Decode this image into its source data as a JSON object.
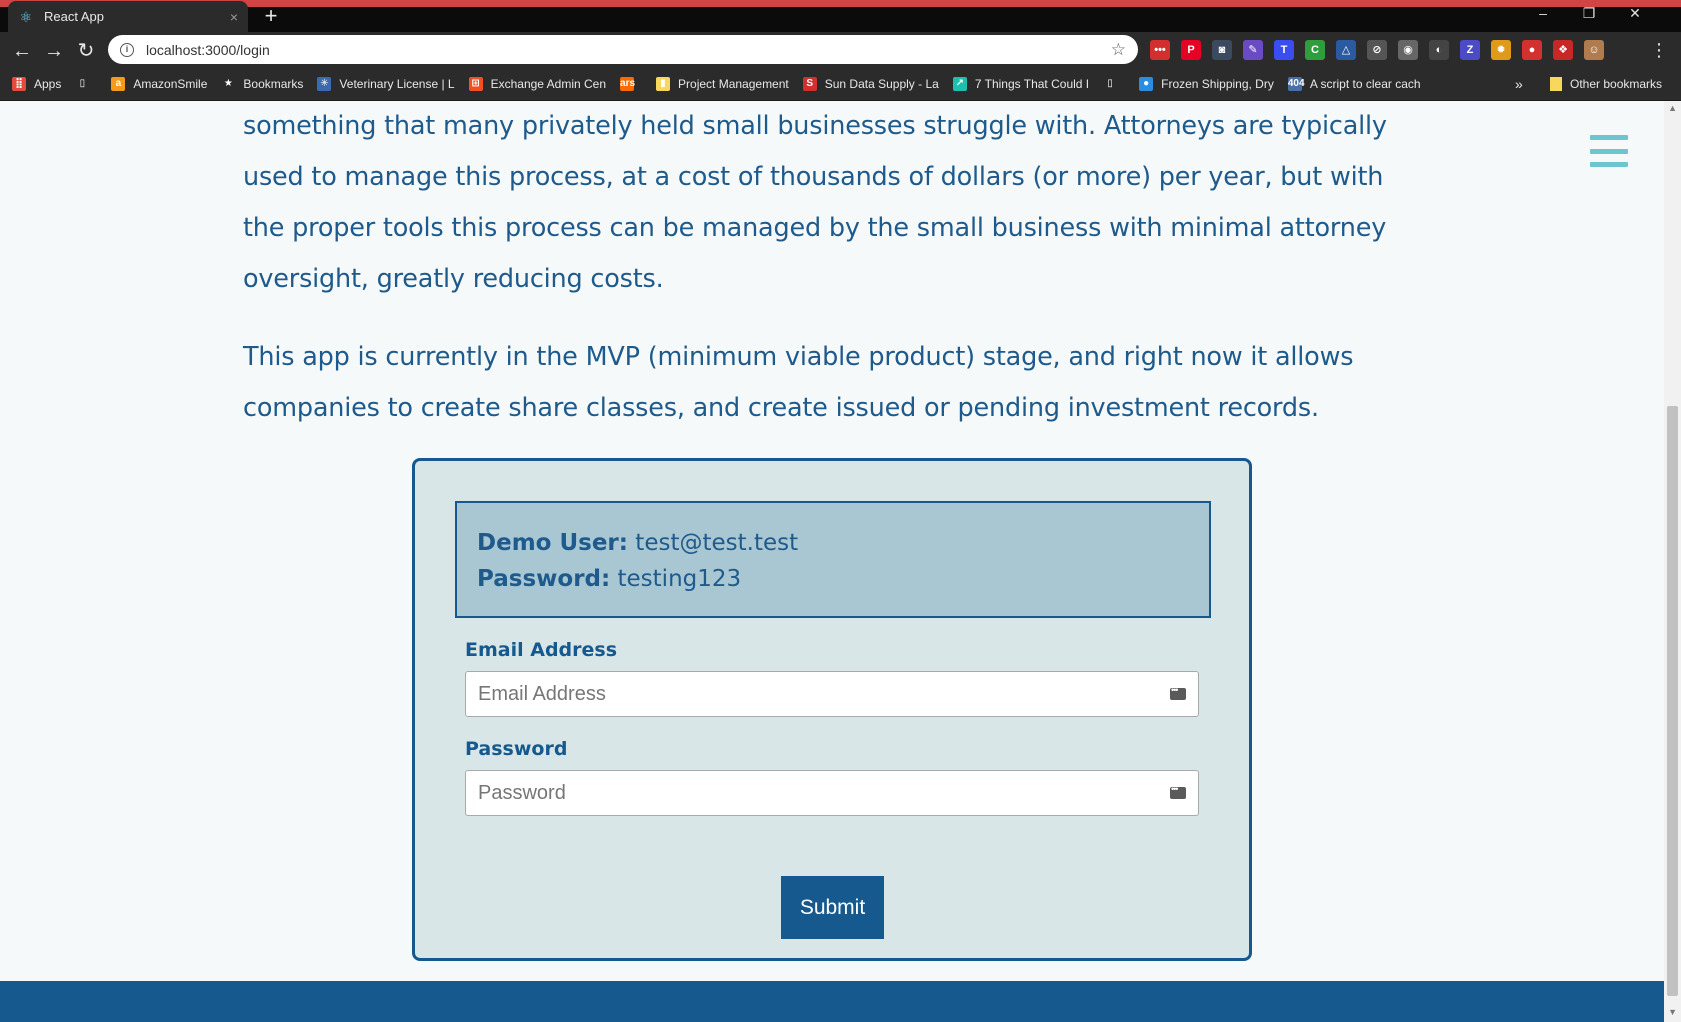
{
  "browser": {
    "tab_title": "React App",
    "tab_close": "×",
    "new_tab": "+",
    "url": "localhost:3000/login",
    "window_controls": {
      "minimize": "–",
      "restore": "❐",
      "close": "✕"
    },
    "nav": {
      "back": "←",
      "forward": "→",
      "reload": "↻"
    },
    "menu": "⋮",
    "extensions": [
      {
        "name": "ext-red-dots",
        "glyph": "•••",
        "color": "#d32f2f"
      },
      {
        "name": "pinterest-icon",
        "glyph": "P",
        "color": "#e60023"
      },
      {
        "name": "ext-grey-square",
        "glyph": "◙",
        "color": "#3c4a60"
      },
      {
        "name": "pen-icon",
        "glyph": "✎",
        "color": "#6a4bc4"
      },
      {
        "name": "ext-blue-t",
        "glyph": "T",
        "color": "#3a4df0"
      },
      {
        "name": "cors-icon",
        "glyph": "C",
        "color": "#2e9d3d"
      },
      {
        "name": "triangle-icon",
        "glyph": "△",
        "color": "#2c5aa0"
      },
      {
        "name": "ext-gear-grey",
        "glyph": "⊘",
        "color": "#555555"
      },
      {
        "name": "camera-icon",
        "glyph": "◉",
        "color": "#666666"
      },
      {
        "name": "contrast-icon",
        "glyph": "◐",
        "color": "#444444"
      },
      {
        "name": "ext-z",
        "glyph": "Z",
        "color": "#4b4bc8"
      },
      {
        "name": "ext-orange-gear",
        "glyph": "✹",
        "color": "#e09a1a"
      },
      {
        "name": "ext-red-circle",
        "glyph": "●",
        "color": "#d33030"
      },
      {
        "name": "ext-red-gift",
        "glyph": "❖",
        "color": "#c62828"
      },
      {
        "name": "profile-avatar",
        "glyph": "☺",
        "color": "#b07c4f"
      }
    ]
  },
  "bookmarks": {
    "items": [
      {
        "label": "Apps",
        "icon": "⣿",
        "color": "#e34b3c"
      },
      {
        "label": "",
        "icon": "▯",
        "color": "#2b2b2b"
      },
      {
        "label": "AmazonSmile",
        "icon": "a",
        "color": "#f49b1c"
      },
      {
        "label": "Bookmarks",
        "icon": "★",
        "color": "#2b2b2b"
      },
      {
        "label": "Veterinary License | L",
        "icon": "✳",
        "color": "#3a6ab0"
      },
      {
        "label": "Exchange Admin Cen",
        "icon": "⊞",
        "color": "#f25022"
      },
      {
        "label": "",
        "icon": "ars",
        "color": "#ff6a00"
      },
      {
        "label": "Project Management",
        "icon": "▮",
        "color": "#f7d85c"
      },
      {
        "label": "Sun Data Supply - La",
        "icon": "S",
        "color": "#d32f2f"
      },
      {
        "label": "7 Things That Could I",
        "icon": "↗",
        "color": "#1fbfb0"
      },
      {
        "label": "",
        "icon": "▯",
        "color": "#2b2b2b"
      },
      {
        "label": "Frozen Shipping, Dry",
        "icon": "●",
        "color": "#2a8de0"
      },
      {
        "label": "A script to clear cach",
        "icon": "404",
        "color": "#4a6fa5"
      }
    ],
    "more": "»",
    "other": "Other bookmarks"
  },
  "page": {
    "paragraphs": [
      "something that many privately held small businesses struggle with. Attorneys are typically used to manage this process, at a cost of thousands of dollars (or more) per year, but with the proper tools this process can be managed by the small business with minimal attorney oversight, greatly reducing costs.",
      "This app is currently in the MVP (minimum viable product) stage, and right now it allows companies to create share classes, and create issued or pending investment records."
    ],
    "demo": {
      "user_label": "Demo User:",
      "user_value": "test@test.test",
      "password_label": "Password:",
      "password_value": "testing123"
    },
    "form": {
      "email_label": "Email Address",
      "email_placeholder": "Email Address",
      "email_value": "",
      "password_label": "Password",
      "password_placeholder": "Password",
      "password_value": "",
      "submit_label": "Submit"
    },
    "colors": {
      "primary": "#15598f",
      "text": "#1e5a8c",
      "card_bg": "#d9e6e8",
      "demo_bg": "#a8c7d3",
      "hamburger": "#6cc5cf",
      "page_bg": "#f6f9f9"
    }
  }
}
